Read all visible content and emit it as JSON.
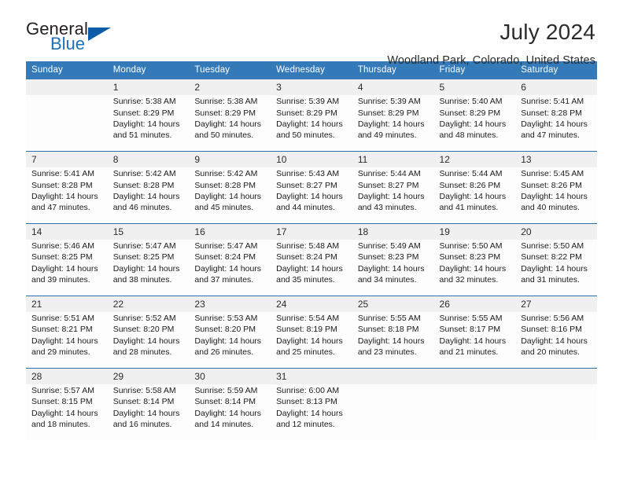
{
  "logo": {
    "line1": "General",
    "line2": "Blue",
    "triangle_icon": "blue-triangle-icon",
    "accent_color": "#1d70b8"
  },
  "header": {
    "month_title": "July 2024",
    "location": "Woodland Park, Colorado, United States"
  },
  "theme": {
    "header_blue": "#357ab8",
    "separator_blue": "#2f6fad",
    "daynum_band": "#f0f0f0",
    "cell_background": "#fdfdfd",
    "text": "#1a1a1a"
  },
  "calendar": {
    "weekday_headers": [
      "Sunday",
      "Monday",
      "Tuesday",
      "Wednesday",
      "Thursday",
      "Friday",
      "Saturday"
    ],
    "weeks": [
      [
        {
          "day": "",
          "lines": []
        },
        {
          "day": "1",
          "lines": [
            "Sunrise: 5:38 AM",
            "Sunset: 8:29 PM",
            "Daylight: 14 hours",
            "and 51 minutes."
          ]
        },
        {
          "day": "2",
          "lines": [
            "Sunrise: 5:38 AM",
            "Sunset: 8:29 PM",
            "Daylight: 14 hours",
            "and 50 minutes."
          ]
        },
        {
          "day": "3",
          "lines": [
            "Sunrise: 5:39 AM",
            "Sunset: 8:29 PM",
            "Daylight: 14 hours",
            "and 50 minutes."
          ]
        },
        {
          "day": "4",
          "lines": [
            "Sunrise: 5:39 AM",
            "Sunset: 8:29 PM",
            "Daylight: 14 hours",
            "and 49 minutes."
          ]
        },
        {
          "day": "5",
          "lines": [
            "Sunrise: 5:40 AM",
            "Sunset: 8:29 PM",
            "Daylight: 14 hours",
            "and 48 minutes."
          ]
        },
        {
          "day": "6",
          "lines": [
            "Sunrise: 5:41 AM",
            "Sunset: 8:28 PM",
            "Daylight: 14 hours",
            "and 47 minutes."
          ]
        }
      ],
      [
        {
          "day": "7",
          "lines": [
            "Sunrise: 5:41 AM",
            "Sunset: 8:28 PM",
            "Daylight: 14 hours",
            "and 47 minutes."
          ]
        },
        {
          "day": "8",
          "lines": [
            "Sunrise: 5:42 AM",
            "Sunset: 8:28 PM",
            "Daylight: 14 hours",
            "and 46 minutes."
          ]
        },
        {
          "day": "9",
          "lines": [
            "Sunrise: 5:42 AM",
            "Sunset: 8:28 PM",
            "Daylight: 14 hours",
            "and 45 minutes."
          ]
        },
        {
          "day": "10",
          "lines": [
            "Sunrise: 5:43 AM",
            "Sunset: 8:27 PM",
            "Daylight: 14 hours",
            "and 44 minutes."
          ]
        },
        {
          "day": "11",
          "lines": [
            "Sunrise: 5:44 AM",
            "Sunset: 8:27 PM",
            "Daylight: 14 hours",
            "and 43 minutes."
          ]
        },
        {
          "day": "12",
          "lines": [
            "Sunrise: 5:44 AM",
            "Sunset: 8:26 PM",
            "Daylight: 14 hours",
            "and 41 minutes."
          ]
        },
        {
          "day": "13",
          "lines": [
            "Sunrise: 5:45 AM",
            "Sunset: 8:26 PM",
            "Daylight: 14 hours",
            "and 40 minutes."
          ]
        }
      ],
      [
        {
          "day": "14",
          "lines": [
            "Sunrise: 5:46 AM",
            "Sunset: 8:25 PM",
            "Daylight: 14 hours",
            "and 39 minutes."
          ]
        },
        {
          "day": "15",
          "lines": [
            "Sunrise: 5:47 AM",
            "Sunset: 8:25 PM",
            "Daylight: 14 hours",
            "and 38 minutes."
          ]
        },
        {
          "day": "16",
          "lines": [
            "Sunrise: 5:47 AM",
            "Sunset: 8:24 PM",
            "Daylight: 14 hours",
            "and 37 minutes."
          ]
        },
        {
          "day": "17",
          "lines": [
            "Sunrise: 5:48 AM",
            "Sunset: 8:24 PM",
            "Daylight: 14 hours",
            "and 35 minutes."
          ]
        },
        {
          "day": "18",
          "lines": [
            "Sunrise: 5:49 AM",
            "Sunset: 8:23 PM",
            "Daylight: 14 hours",
            "and 34 minutes."
          ]
        },
        {
          "day": "19",
          "lines": [
            "Sunrise: 5:50 AM",
            "Sunset: 8:23 PM",
            "Daylight: 14 hours",
            "and 32 minutes."
          ]
        },
        {
          "day": "20",
          "lines": [
            "Sunrise: 5:50 AM",
            "Sunset: 8:22 PM",
            "Daylight: 14 hours",
            "and 31 minutes."
          ]
        }
      ],
      [
        {
          "day": "21",
          "lines": [
            "Sunrise: 5:51 AM",
            "Sunset: 8:21 PM",
            "Daylight: 14 hours",
            "and 29 minutes."
          ]
        },
        {
          "day": "22",
          "lines": [
            "Sunrise: 5:52 AM",
            "Sunset: 8:20 PM",
            "Daylight: 14 hours",
            "and 28 minutes."
          ]
        },
        {
          "day": "23",
          "lines": [
            "Sunrise: 5:53 AM",
            "Sunset: 8:20 PM",
            "Daylight: 14 hours",
            "and 26 minutes."
          ]
        },
        {
          "day": "24",
          "lines": [
            "Sunrise: 5:54 AM",
            "Sunset: 8:19 PM",
            "Daylight: 14 hours",
            "and 25 minutes."
          ]
        },
        {
          "day": "25",
          "lines": [
            "Sunrise: 5:55 AM",
            "Sunset: 8:18 PM",
            "Daylight: 14 hours",
            "and 23 minutes."
          ]
        },
        {
          "day": "26",
          "lines": [
            "Sunrise: 5:55 AM",
            "Sunset: 8:17 PM",
            "Daylight: 14 hours",
            "and 21 minutes."
          ]
        },
        {
          "day": "27",
          "lines": [
            "Sunrise: 5:56 AM",
            "Sunset: 8:16 PM",
            "Daylight: 14 hours",
            "and 20 minutes."
          ]
        }
      ],
      [
        {
          "day": "28",
          "lines": [
            "Sunrise: 5:57 AM",
            "Sunset: 8:15 PM",
            "Daylight: 14 hours",
            "and 18 minutes."
          ]
        },
        {
          "day": "29",
          "lines": [
            "Sunrise: 5:58 AM",
            "Sunset: 8:14 PM",
            "Daylight: 14 hours",
            "and 16 minutes."
          ]
        },
        {
          "day": "30",
          "lines": [
            "Sunrise: 5:59 AM",
            "Sunset: 8:14 PM",
            "Daylight: 14 hours",
            "and 14 minutes."
          ]
        },
        {
          "day": "31",
          "lines": [
            "Sunrise: 6:00 AM",
            "Sunset: 8:13 PM",
            "Daylight: 14 hours",
            "and 12 minutes."
          ]
        },
        {
          "day": "",
          "lines": []
        },
        {
          "day": "",
          "lines": []
        },
        {
          "day": "",
          "lines": []
        }
      ]
    ]
  }
}
